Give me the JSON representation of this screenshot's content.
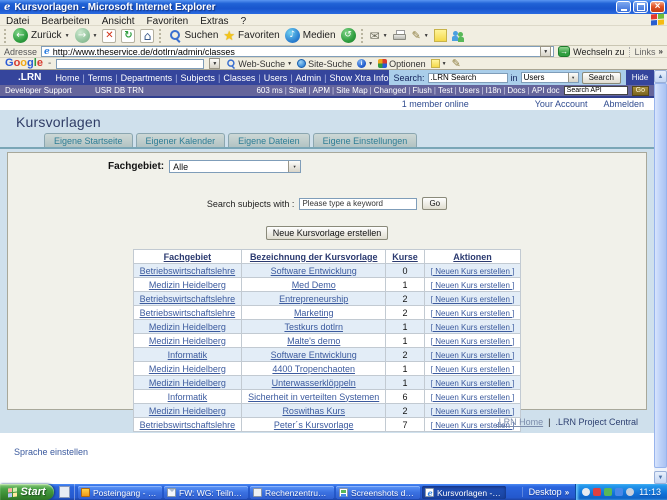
{
  "window": {
    "title": "Kursvorlagen - Microsoft Internet Explorer"
  },
  "menu": {
    "items": [
      "Datei",
      "Bearbeiten",
      "Ansicht",
      "Favoriten",
      "Extras",
      "?"
    ]
  },
  "toolbar": {
    "back_label": "Zurück",
    "search_label": "Suchen",
    "favorites_label": "Favoriten",
    "media_label": "Medien"
  },
  "addressbar": {
    "label": "Adresse",
    "url": "http://www.theservice.de/dotlrn/admin/classes",
    "go_label": "Wechseln zu",
    "links_label": "Links",
    "chevron": "»"
  },
  "google": {
    "logo": "Google",
    "dash": "-",
    "web_search": "Web-Suche",
    "site_search": "Site-Suche",
    "options": "Optionen"
  },
  "lrn_nav": {
    "logo": ".LRN",
    "links": [
      "Home",
      "Terms",
      "Departments",
      "Subjects",
      "Classes",
      "Users",
      "Admin",
      "Show Xtra Info"
    ],
    "search_label": "Search:",
    "search_value": ".LRN Search",
    "in_label": "in",
    "scope_value": "Users",
    "search_button": "Search",
    "hide_me": "Hide me"
  },
  "dev_bar": {
    "product": "Developer Support",
    "flags": "USR DB TRN",
    "links": [
      "603 ms",
      "Shell",
      "APM",
      "Site Map",
      "Changed",
      "Flush",
      "Test",
      "Users",
      "I18n",
      "Docs",
      "API doc"
    ],
    "api_search_value": "Search API",
    "go_label": "Go"
  },
  "status": {
    "members_online": "1 member online",
    "your_account": "Your Account",
    "logout": "Abmelden"
  },
  "page": {
    "title": "Kursvorlagen",
    "tabs": [
      "Eigene Startseite",
      "Eigener Kalender",
      "Eigene Dateien",
      "Eigene Einstellungen"
    ],
    "filter_label": "Fachgebiet:",
    "filter_value": "Alle",
    "subject_search_label": "Search subjects with :",
    "subject_search_value": "Please type a keyword",
    "subject_search_go": "Go",
    "new_template_label": "Neue Kursvorlage erstellen"
  },
  "table": {
    "headers": [
      "Fachgebiet",
      "Bezeichnung der Kursvorlage",
      "Kurse",
      "Aktionen"
    ],
    "action_label": "[ Neuen Kurs erstellen ]",
    "rows": [
      [
        "Betriebswirtschaftslehre",
        "Software Entwicklung",
        "0"
      ],
      [
        "Medizin Heidelberg",
        "Med Demo",
        "1"
      ],
      [
        "Betriebswirtschaftslehre",
        "Entrepreneurship",
        "2"
      ],
      [
        "Betriebswirtschaftslehre",
        "Marketing",
        "2"
      ],
      [
        "Medizin Heidelberg",
        "Testkurs dotlrn",
        "1"
      ],
      [
        "Medizin Heidelberg",
        "Malte's demo",
        "1"
      ],
      [
        "Informatik",
        "Software Entwicklung",
        "2"
      ],
      [
        "Medizin Heidelberg",
        "4400 Tropenchaoten",
        "1"
      ],
      [
        "Medizin Heidelberg",
        "Unterwasserklöppeln",
        "1"
      ],
      [
        "Informatik",
        "Sicherheit in verteilten Systemen",
        "6"
      ],
      [
        "Medizin Heidelberg",
        "Roswithas Kurs",
        "2"
      ],
      [
        "Betriebswirtschaftslehre",
        "Peter´s Kursvorlage",
        "7"
      ]
    ]
  },
  "footer": {
    "links": [
      ".LRN Home",
      ".LRN Project Central"
    ],
    "language_link": "Sprache einstellen"
  },
  "taskbar": {
    "start_label": "Start",
    "tasks": [
      {
        "label": "Posteingang - Micros....",
        "icon": "outlook",
        "active": false
      },
      {
        "label": "FW: WG: Teilnahme v...",
        "icon": "mailmsg",
        "active": false
      },
      {
        "label": "Rechenzentrum Uni K...",
        "icon": "doc",
        "active": false
      },
      {
        "label": "Screenshots dotLRN....",
        "icon": "imgdoc",
        "active": false
      },
      {
        "label": "Kursvorlagen - Micros...",
        "icon": "iepage",
        "active": true
      }
    ],
    "desktop_label": "Desktop",
    "desktop_chevron": "»",
    "time": "11:13"
  },
  "colors": {
    "navbar_blue": "#35459c",
    "devbar_purple": "#65659b",
    "page_background": "#cfe0ec",
    "tab_text_teal": "#2e7d95",
    "link_blue": "#3b5a9e",
    "row_alt_blue": "#e3edf7",
    "taskbar_blue": "#2458cd",
    "start_green": "#37862f"
  }
}
